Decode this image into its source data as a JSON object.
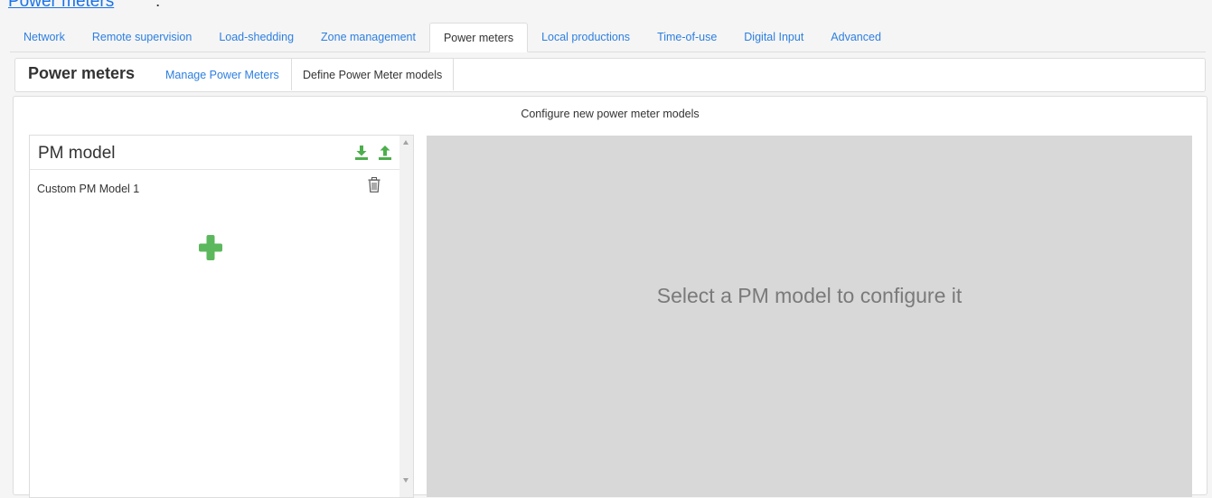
{
  "page_link": {
    "label": "Power meters",
    "suffix": " :"
  },
  "main_tabs": [
    {
      "label": "Network",
      "active": false
    },
    {
      "label": "Remote supervision",
      "active": false
    },
    {
      "label": "Load-shedding",
      "active": false
    },
    {
      "label": "Zone management",
      "active": false
    },
    {
      "label": "Power meters",
      "active": true
    },
    {
      "label": "Local productions",
      "active": false
    },
    {
      "label": "Time-of-use",
      "active": false
    },
    {
      "label": "Digital Input",
      "active": false
    },
    {
      "label": "Advanced",
      "active": false
    }
  ],
  "sub_nav": {
    "title": "Power meters",
    "tabs": [
      {
        "label": "Manage Power Meters",
        "active": false
      },
      {
        "label": "Define Power Meter models",
        "active": true
      }
    ]
  },
  "content": {
    "heading": "Configure new power meter models",
    "pm_list": {
      "title": "PM model",
      "items": [
        {
          "label": "Custom PM Model 1"
        }
      ]
    },
    "config_placeholder": "Select a PM model to configure it"
  },
  "colors": {
    "link": "#2d7fe0",
    "accent_green": "#4cae4c",
    "config_bg": "#d8d8d8"
  },
  "icons": {
    "download": "download-icon",
    "upload": "upload-icon",
    "delete": "trash-icon",
    "add": "plus-icon"
  }
}
